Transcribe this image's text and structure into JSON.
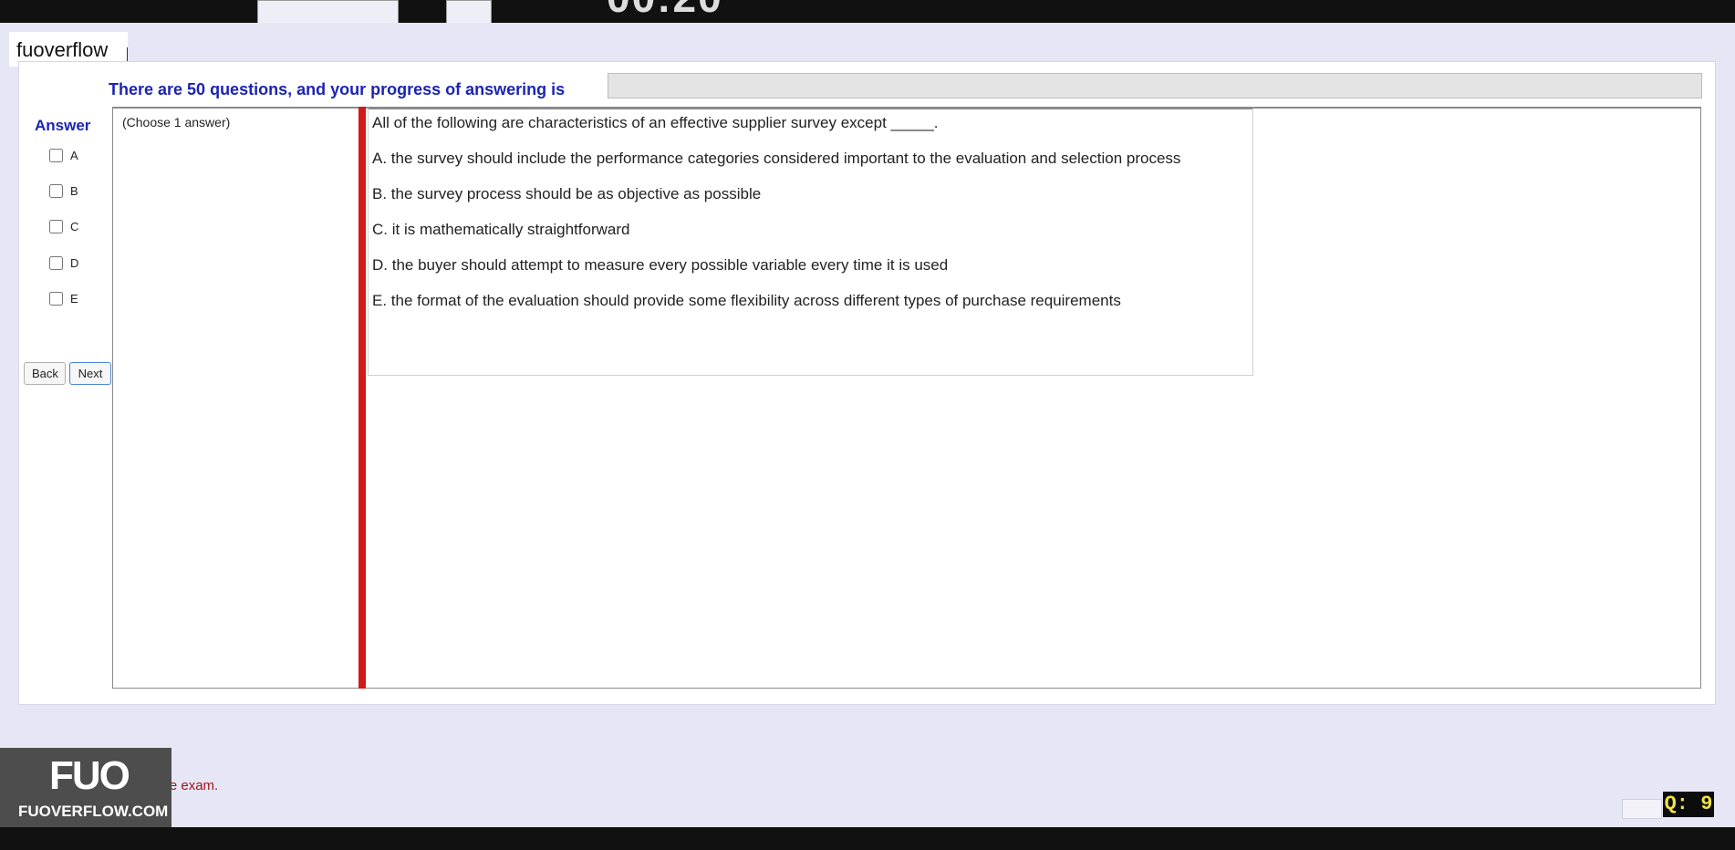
{
  "watermark": "fuoverflow",
  "progress": {
    "label": "There are 50 questions, and your progress of answering is",
    "fraction": 0
  },
  "answer_panel": {
    "title": "Answer",
    "options": [
      "A",
      "B",
      "C",
      "D",
      "E"
    ],
    "back_label": "Back",
    "next_label": "Next"
  },
  "question": {
    "instruction": "(Choose 1 answer)",
    "text": "All of the following are characteristics of an effective supplier survey except _____.",
    "choices": [
      "A.  the survey should include the performance categories considered important to the evaluation and selection process",
      "B.  the survey process should be as objective as possible",
      "C.  it is mathematically straightforward",
      "D.  the buyer should attempt to measure every possible variable every time it is used",
      "E.  the format of the evaluation should provide some flexibility across different types of purchase requirements"
    ]
  },
  "logo": {
    "mark": "FUO",
    "url": "FUOVERFLOW.COM"
  },
  "finish_text": "ish the exam.",
  "counter": "Q: 9",
  "colors": {
    "accent": "#1c24b4",
    "divider": "#d21a1a",
    "counter_text": "#f0e24a"
  }
}
